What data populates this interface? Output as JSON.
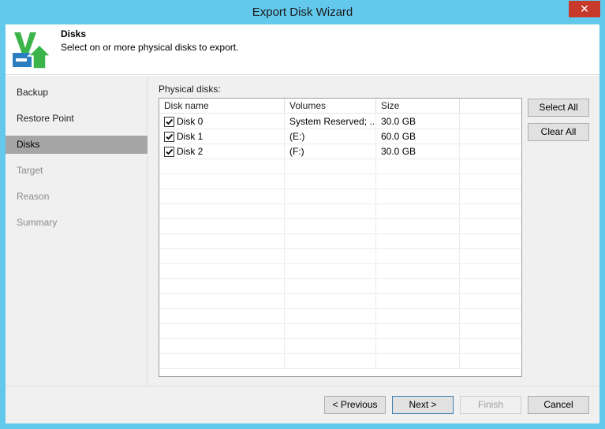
{
  "window": {
    "title": "Export Disk Wizard",
    "close_glyph": "✕"
  },
  "header": {
    "title": "Disks",
    "subtitle": "Select on or more physical disks to export.",
    "logo_icon": "veeam-export-icon"
  },
  "steps": [
    {
      "label": "Backup",
      "state": "done"
    },
    {
      "label": "Restore Point",
      "state": "done"
    },
    {
      "label": "Disks",
      "state": "active"
    },
    {
      "label": "Target",
      "state": "disabled"
    },
    {
      "label": "Reason",
      "state": "disabled"
    },
    {
      "label": "Summary",
      "state": "disabled"
    }
  ],
  "content": {
    "label": "Physical disks:",
    "columns": [
      "Disk name",
      "Volumes",
      "Size",
      ""
    ],
    "rows": [
      {
        "name": "Disk 0",
        "volumes": "System Reserved; ...",
        "size": "30.0 GB",
        "checked": true
      },
      {
        "name": "Disk 1",
        "volumes": "(E:)",
        "size": "60.0 GB",
        "checked": true
      },
      {
        "name": "Disk 2",
        "volumes": "(F:)",
        "size": "30.0 GB",
        "checked": true
      }
    ],
    "select_all": "Select All",
    "clear_all": "Clear All"
  },
  "footer": {
    "previous": "< Previous",
    "next": "Next >",
    "finish": "Finish",
    "cancel": "Cancel"
  },
  "colors": {
    "frame": "#62c8ec",
    "active_step": "#a5a5a5",
    "logo_green": "#3bb54a",
    "logo_blue": "#2b7fc1"
  }
}
